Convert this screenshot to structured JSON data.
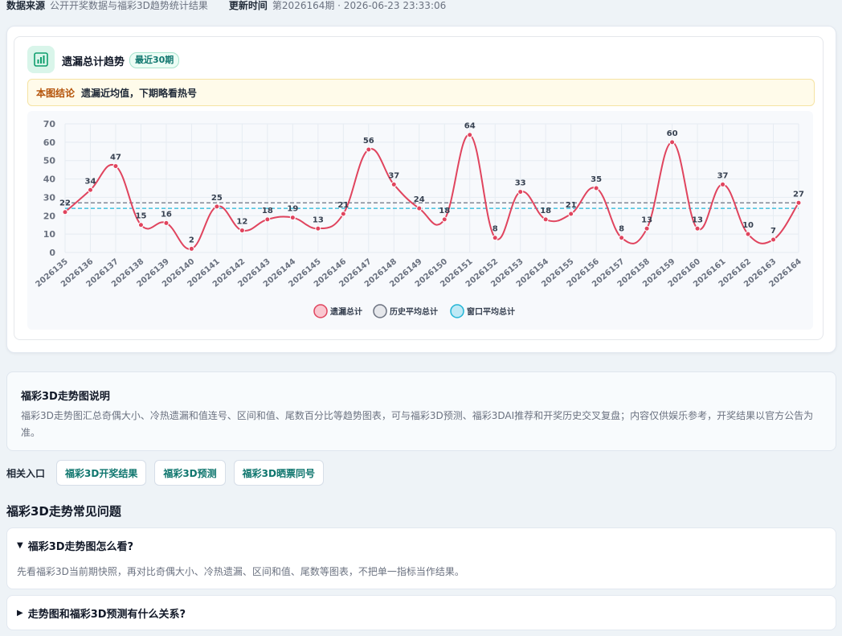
{
  "meta": {
    "source_key": "数据来源",
    "source_val": "公开开奖数据与福彩3D趋势统计结果",
    "update_key": "更新时间",
    "update_val": "第2026164期 · 2026-06-23 23:33:06"
  },
  "chart_card": {
    "title": "遗漏总计趋势",
    "badge": "最近30期",
    "conclusion_key": "本图结论",
    "conclusion_text": "遗漏近均值，下期略看热号",
    "icon": "bar-chart-icon"
  },
  "chart_data": {
    "type": "line",
    "categories": [
      "2026135",
      "2026136",
      "2026137",
      "2026138",
      "2026139",
      "2026140",
      "2026141",
      "2026142",
      "2026143",
      "2026144",
      "2026145",
      "2026146",
      "2026147",
      "2026148",
      "2026149",
      "2026150",
      "2026151",
      "2026152",
      "2026153",
      "2026154",
      "2026155",
      "2026156",
      "2026157",
      "2026158",
      "2026159",
      "2026160",
      "2026161",
      "2026162",
      "2026163",
      "2026164"
    ],
    "series": [
      {
        "name": "遗漏总计",
        "values": [
          22,
          34,
          47,
          15,
          16,
          2,
          25,
          12,
          18,
          19,
          13,
          21,
          56,
          37,
          24,
          18,
          64,
          8,
          33,
          18,
          21,
          35,
          8,
          13,
          60,
          13,
          37,
          10,
          7,
          27
        ],
        "color": "#e0445e"
      },
      {
        "name": "历史平均总计",
        "values": [
          27
        ],
        "color": "#6b7280",
        "style": "dashed"
      },
      {
        "name": "窗口平均总计",
        "values": [
          24
        ],
        "color": "#22b5d6",
        "style": "dashed"
      }
    ],
    "ylim": [
      0,
      70
    ],
    "yticks": [
      0,
      10,
      20,
      30,
      40,
      50,
      60,
      70
    ],
    "grid": true,
    "legend": "bottom"
  },
  "description": {
    "title": "福彩3D走势图说明",
    "text": "福彩3D走势图汇总奇偶大小、冷热遗漏和值连号、区间和值、尾数百分比等趋势图表，可与福彩3D预测、福彩3DAI推荐和开奖历史交叉复盘；内容仅供娱乐参考，开奖结果以官方公告为准。"
  },
  "related": {
    "label": "相关入口",
    "links": [
      "福彩3D开奖结果",
      "福彩3D预测",
      "福彩3D晒票同号"
    ]
  },
  "faq": {
    "heading": "福彩3D走势常见问题",
    "items": [
      {
        "q": "福彩3D走势图怎么看?",
        "a": "先看福彩3D当前期快照，再对比奇偶大小、冷热遗漏、区间和值、尾数等图表，不把单一指标当作结果。",
        "open": true,
        "arrow": "▼"
      },
      {
        "q": "走势图和福彩3D预测有什么关系?",
        "a": "",
        "open": false,
        "arrow": "▶"
      }
    ]
  }
}
